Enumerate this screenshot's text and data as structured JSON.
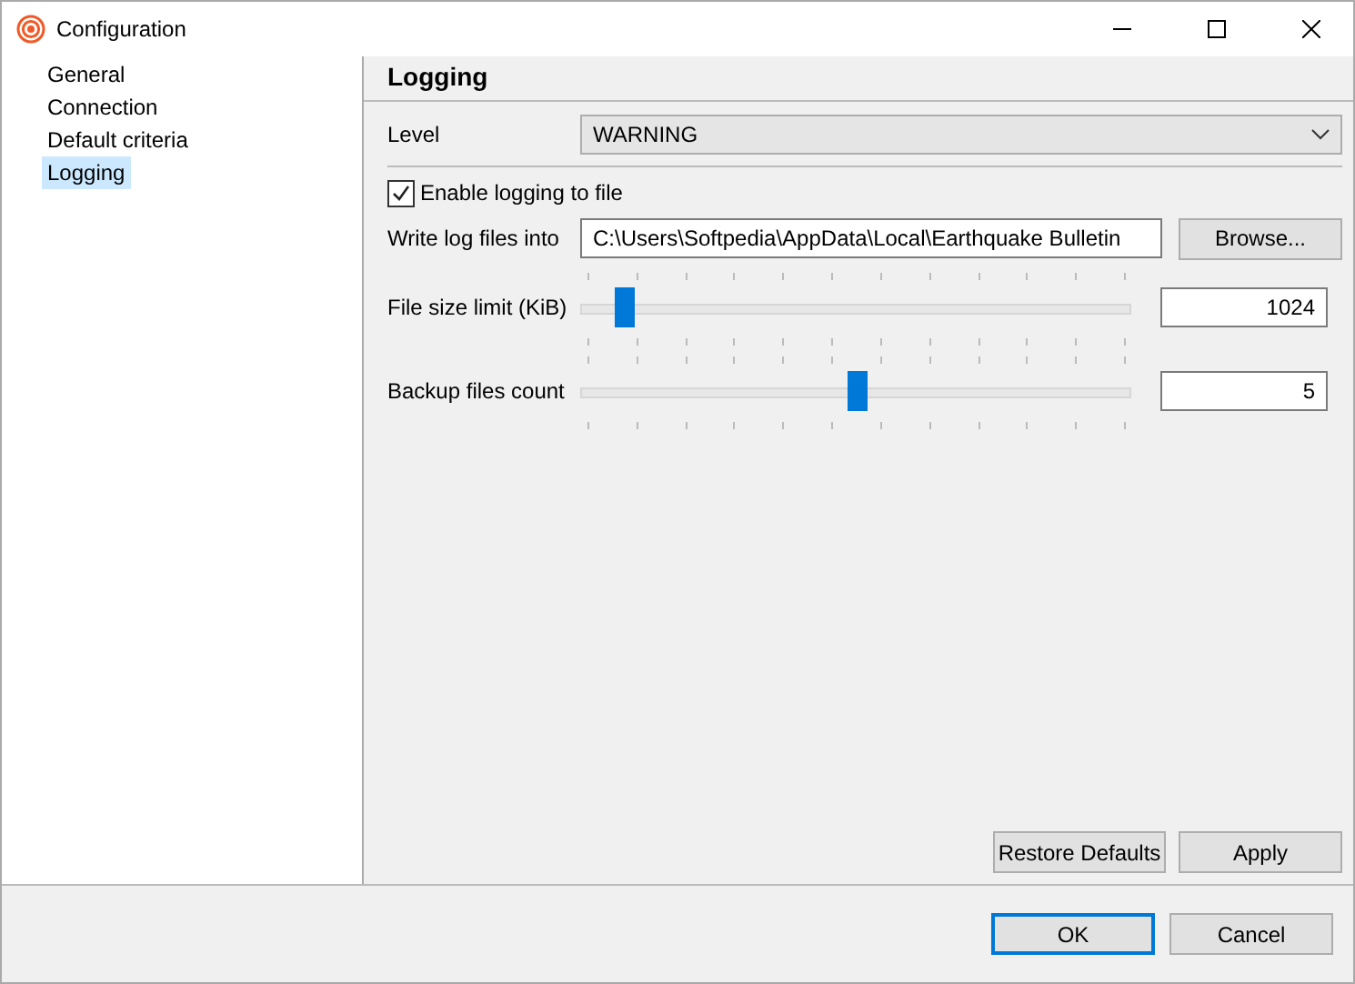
{
  "window": {
    "title": "Configuration"
  },
  "sidebar": {
    "items": [
      {
        "label": "General",
        "selected": false
      },
      {
        "label": "Connection",
        "selected": false
      },
      {
        "label": "Default criteria",
        "selected": false
      },
      {
        "label": "Logging",
        "selected": true
      }
    ]
  },
  "panel": {
    "title": "Logging",
    "level": {
      "label": "Level",
      "value": "WARNING"
    },
    "enable_logging": {
      "label": "Enable logging to file",
      "checked": true
    },
    "log_dir": {
      "label": "Write log files into",
      "value": "C:\\Users\\Softpedia\\AppData\\Local\\Earthquake Bulletin",
      "button": "Browse..."
    },
    "sliders": [
      {
        "label": "File size limit (KiB)",
        "level": 0.08,
        "value": "1024"
      },
      {
        "label": "Backup files count",
        "level": 0.5,
        "value": "5"
      }
    ],
    "buttons": [
      "Restore Defaults",
      "Apply"
    ]
  },
  "footer": {
    "buttons": [
      {
        "label": "OK",
        "default": true
      },
      {
        "label": "Cancel",
        "default": false
      }
    ]
  }
}
